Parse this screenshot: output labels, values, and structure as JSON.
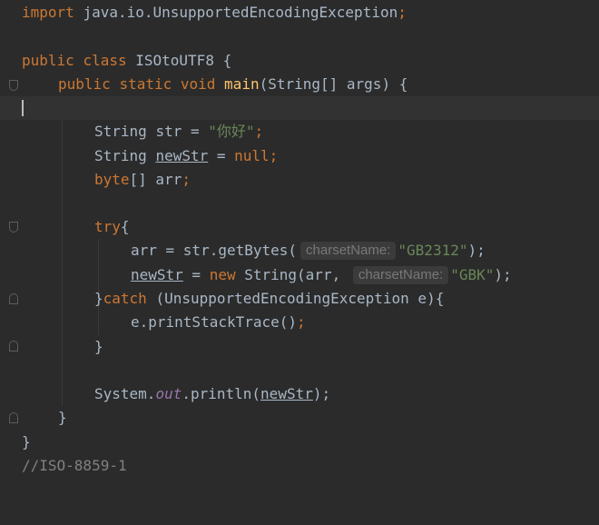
{
  "hint_label": "charsetName:",
  "code": {
    "import_kw": "import",
    "import_path": "java.io.UnsupportedEncodingException",
    "semicolon": ";",
    "public_kw": "public",
    "class_kw": "class",
    "class_name": "ISOtoUTF8",
    "static_kw": "static",
    "void_kw": "void",
    "main_name": "main",
    "main_params": "(String[] args) {",
    "string_type": "String",
    "str_var": "str",
    "equals": " = ",
    "str_literal": "\"你好\"",
    "newstr_var": "newStr",
    "null_kw": "null",
    "byte_kw": "byte",
    "arr_decl": "[] arr",
    "try_kw": "try",
    "open_brace": "{",
    "arr_assign": "arr = str.getBytes(",
    "gb_literal": "\"GB2312\"",
    "close_paren_semi": ");",
    "new_kw": "new",
    "string_ctor": " String(arr, ",
    "gbk_literal": "\"GBK\"",
    "close_brace": "}",
    "catch_kw": "catch",
    "catch_params": " (UnsupportedEncodingException e){",
    "print_stack": "e.printStackTrace()",
    "system": "System.",
    "out_field": "out",
    "println": ".println(",
    "comment": "//ISO-8859-1"
  }
}
